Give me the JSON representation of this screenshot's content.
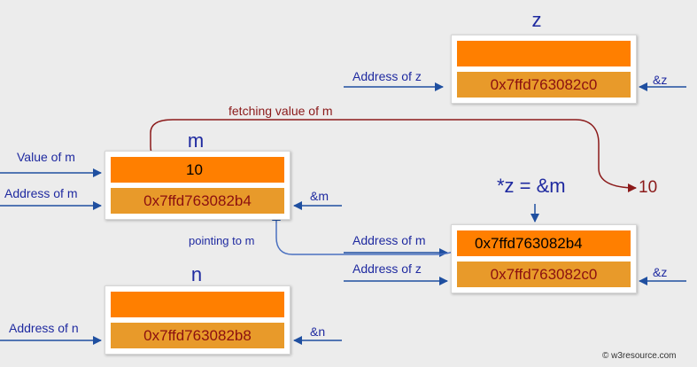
{
  "colors": {
    "accent": "#ff7f00",
    "address_fill": "#e89a2a",
    "arrow_blue": "#1f4fa0",
    "arrow_red": "#8b1a1a",
    "label_blue": "#1f2aa0"
  },
  "z_block": {
    "name": "z",
    "address": "0x7ffd763082c0",
    "left_label": "Address of z",
    "right_label": "&z"
  },
  "m_block": {
    "name": "m",
    "value": "10",
    "address": "0x7ffd763082b4",
    "value_label": "Value of m",
    "left_label": "Address of m",
    "right_label": "&m"
  },
  "n_block": {
    "name": "n",
    "address": "0x7ffd763082b8",
    "left_label": "Address of n",
    "right_label": "&n"
  },
  "ptr_block": {
    "expression": "*z = &m",
    "pointer_value": "0x7ffd763082b4",
    "address": "0x7ffd763082c0",
    "top_label": "Address of m",
    "bottom_label": "Address of z",
    "right_label": "&z"
  },
  "annotations": {
    "fetching": "fetching value of m",
    "pointing": "pointing to m",
    "result": "10"
  },
  "watermark": "© w3resource.com"
}
